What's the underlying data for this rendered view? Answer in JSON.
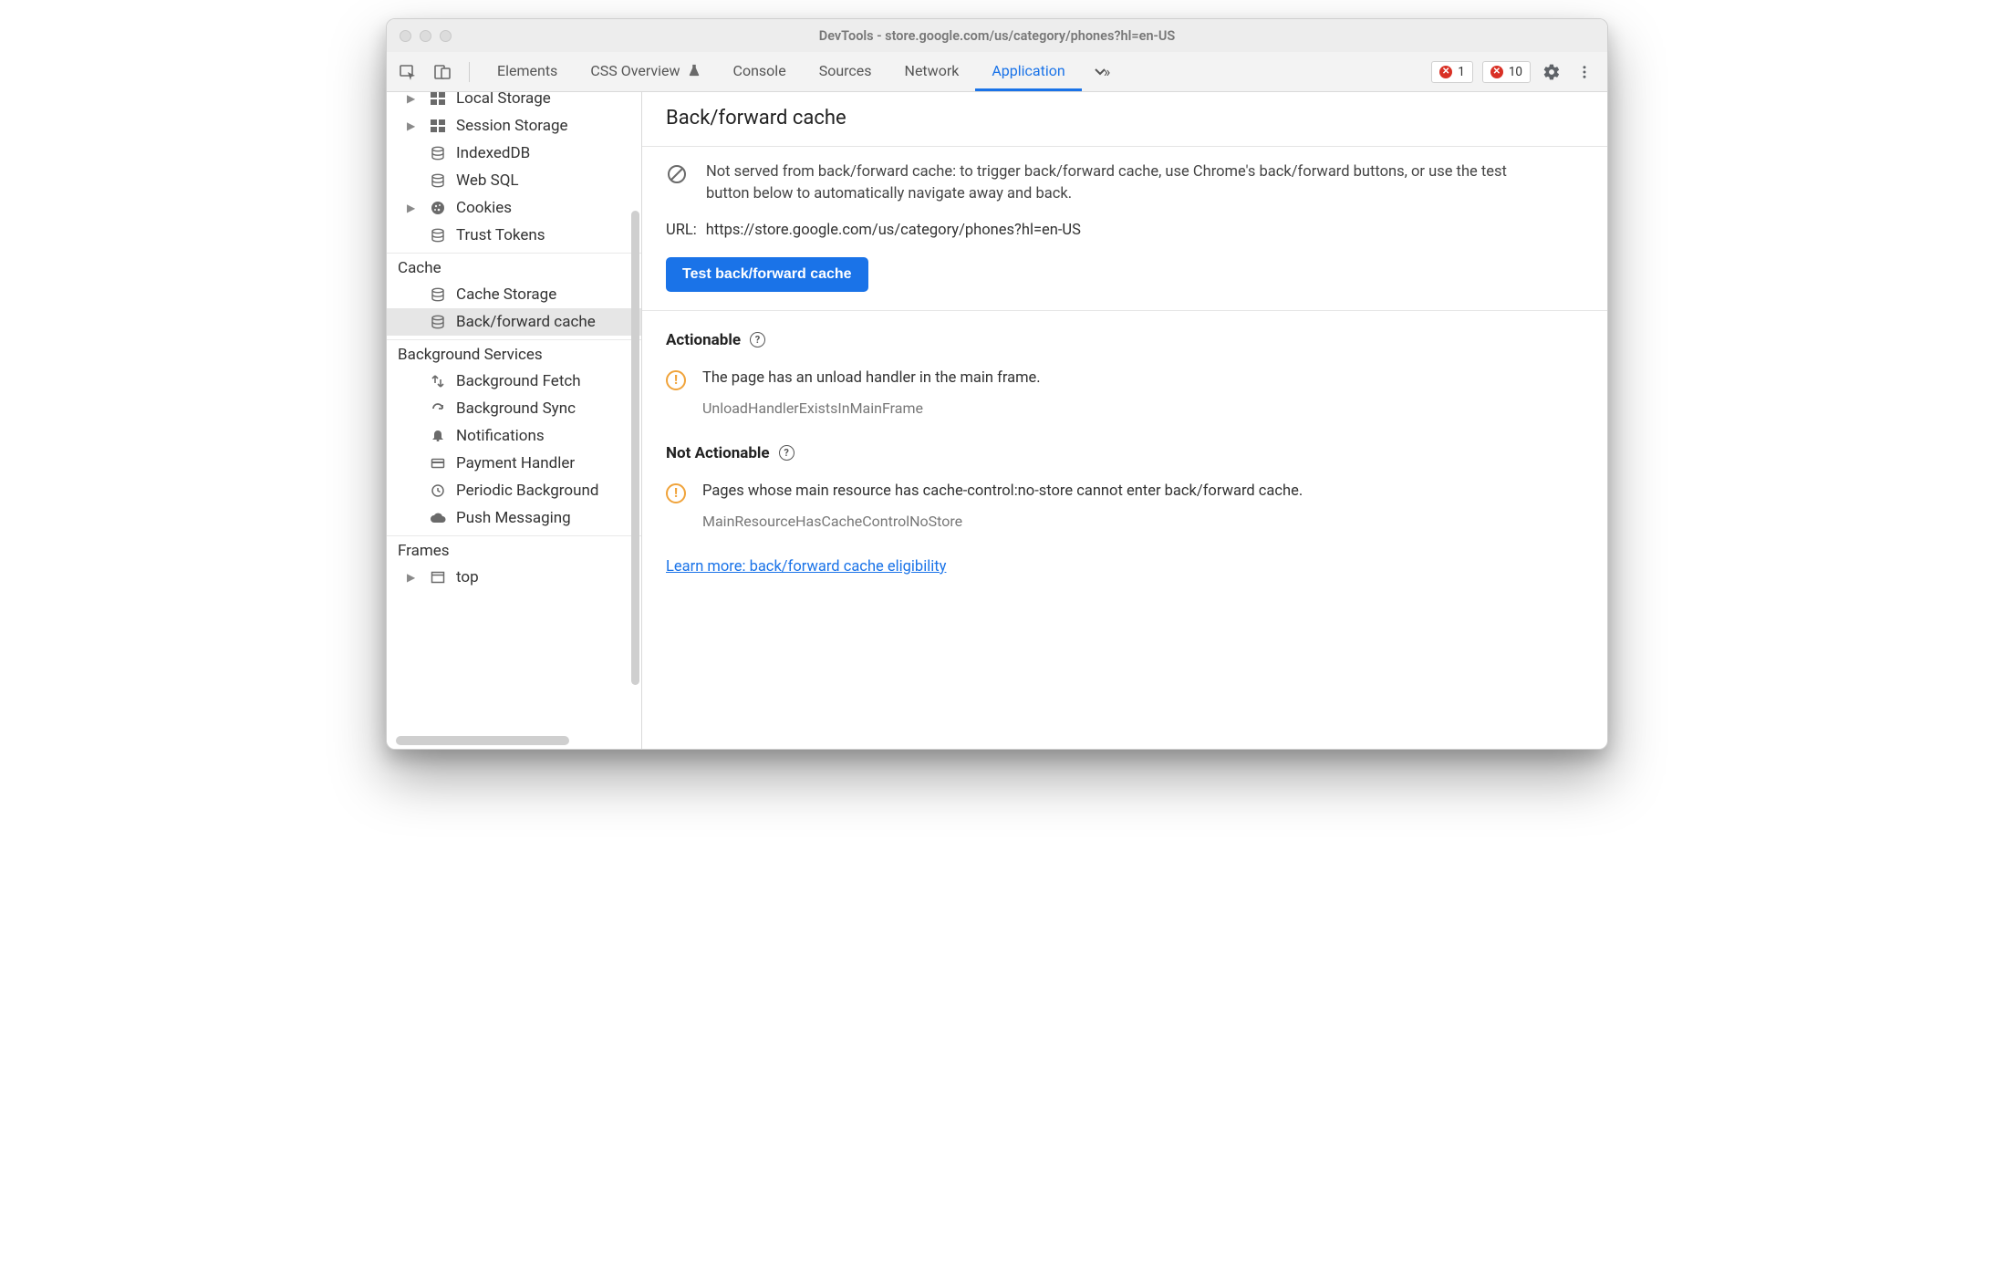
{
  "window": {
    "title": "DevTools - store.google.com/us/category/phones?hl=en-US"
  },
  "tabs": {
    "elements": "Elements",
    "css_overview": "CSS Overview",
    "console": "Console",
    "sources": "Sources",
    "network": "Network",
    "application": "Application"
  },
  "badges": {
    "errors1": "1",
    "errors2": "10"
  },
  "sidebar": {
    "storage": {
      "local": "Local Storage",
      "session": "Session Storage",
      "indexeddb": "IndexedDB",
      "websql": "Web SQL",
      "cookies": "Cookies",
      "trust_tokens": "Trust Tokens"
    },
    "cache_title": "Cache",
    "cache": {
      "cache_storage": "Cache Storage",
      "bf_cache": "Back/forward cache"
    },
    "bg_title": "Background Services",
    "bg": {
      "fetch": "Background Fetch",
      "sync": "Background Sync",
      "notifications": "Notifications",
      "payment": "Payment Handler",
      "periodic": "Periodic Background",
      "push": "Push Messaging"
    },
    "frames_title": "Frames",
    "frames": {
      "top": "top"
    }
  },
  "main": {
    "heading": "Back/forward cache",
    "info": "Not served from back/forward cache: to trigger back/forward cache, use Chrome's back/forward buttons, or use the test button below to automatically navigate away and back.",
    "url_label": "URL:",
    "url_value": "https://store.google.com/us/category/phones?hl=en-US",
    "test_button": "Test back/forward cache",
    "actionable_title": "Actionable",
    "actionable": {
      "message": "The page has an unload handler in the main frame.",
      "code": "UnloadHandlerExistsInMainFrame"
    },
    "not_actionable_title": "Not Actionable",
    "not_actionable": {
      "message": "Pages whose main resource has cache-control:no-store cannot enter back/forward cache.",
      "code": "MainResourceHasCacheControlNoStore"
    },
    "learn_more": "Learn more: back/forward cache eligibility"
  }
}
